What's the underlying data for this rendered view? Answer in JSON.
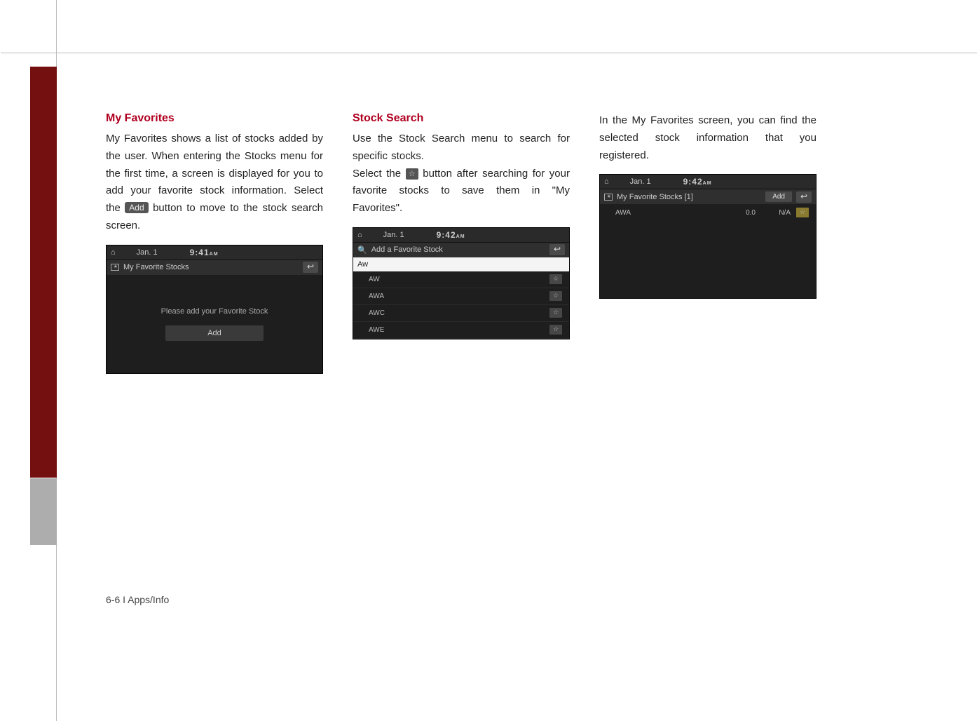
{
  "page_footer": "6-6 I Apps/Info",
  "col1": {
    "heading": "My Favorites",
    "para_a": "My Favorites shows a list of stocks added by the user. When entering the Stocks menu for the first time, a screen is displayed for you to add your favorite stock information. Select the ",
    "inline_button": "Add",
    "para_b": " button to move to the stock search screen.",
    "shot": {
      "date": "Jan. 1",
      "time": "9:41",
      "time_suffix": "AM",
      "title": "My Favorite Stocks",
      "empty_message": "Please add your Favorite Stock",
      "add_button": "Add"
    }
  },
  "col2": {
    "heading": "Stock Search",
    "para_a": "Use the Stock Search menu to search for specific stocks.",
    "para_b_pre": "Select the ",
    "inline_star": "☆",
    "para_b_post": " button after searching for your favorite stocks to save them in \"My Favorites\".",
    "shot": {
      "date": "Jan. 1",
      "time": "9:42",
      "time_suffix": "AM",
      "title": "Add a Favorite Stock",
      "search_value": "Aw",
      "results": [
        "AW",
        "AWA",
        "AWC",
        "AWE"
      ]
    }
  },
  "col3": {
    "para": "In the My Favorites screen, you can find the selected stock information that you registered.",
    "shot": {
      "date": "Jan. 1",
      "time": "9:42",
      "time_suffix": "AM",
      "title": "My Favorite Stocks [1]",
      "add_button": "Add",
      "row": {
        "symbol": "AWA",
        "value": "0.0",
        "status": "N/A"
      }
    }
  }
}
